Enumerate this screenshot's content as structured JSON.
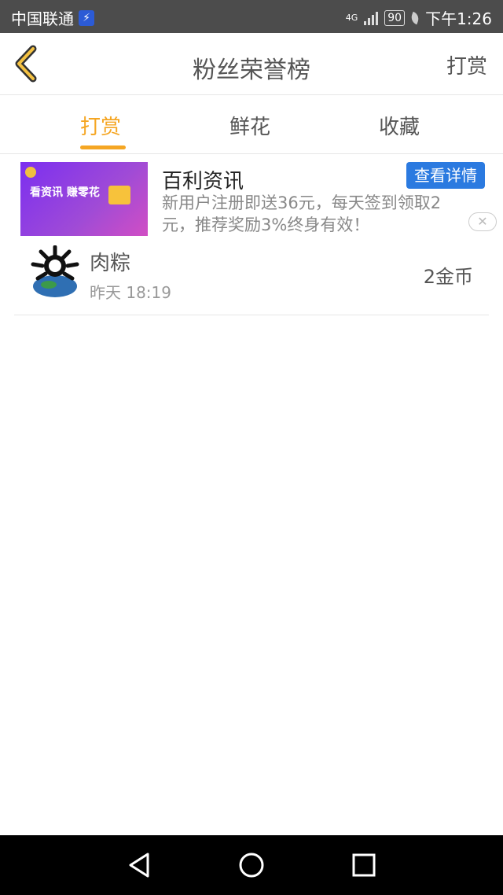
{
  "status_bar": {
    "carrier": "中国联通",
    "network": "4G",
    "battery": "90",
    "time": "下午1:26"
  },
  "header": {
    "title": "粉丝荣誉榜",
    "right_action": "打赏"
  },
  "tabs": [
    {
      "label": "打赏",
      "active": true
    },
    {
      "label": "鲜花",
      "active": false
    },
    {
      "label": "收藏",
      "active": false
    }
  ],
  "ad": {
    "image_text_1": "看资讯 赚零花",
    "title": "百利资讯",
    "description": "新用户注册即送36元，每天签到领取2元，推荐奖励3%终身有效！",
    "button_label": "查看详情",
    "close_glyph": "✕"
  },
  "list": [
    {
      "name": "肉粽",
      "time": "昨天 18:19",
      "amount": "2金币"
    }
  ],
  "colors": {
    "accent": "#f5a623",
    "ad_button": "#2b7ae0",
    "status_bar": "#4c4c4c"
  }
}
